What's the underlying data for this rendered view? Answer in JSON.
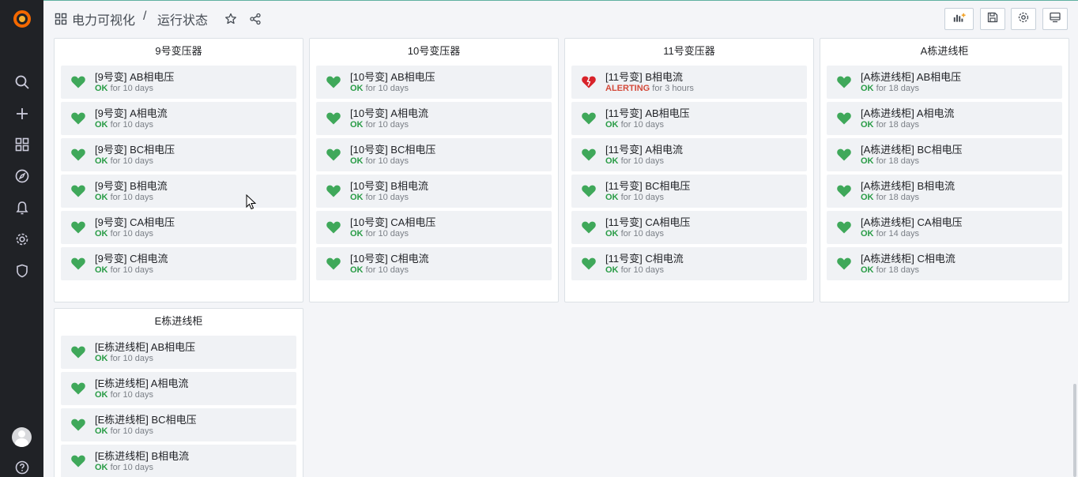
{
  "breadcrumb": {
    "folder": "电力可视化",
    "separator": "/",
    "dashboard": "运行状态"
  },
  "icons": {
    "logo": "grafana-logo-icon",
    "sidebar": [
      "search-icon",
      "plus-icon",
      "dashboards-grid-icon",
      "compass-explore-icon",
      "bell-alerting-icon",
      "gear-config-icon",
      "shield-icon"
    ],
    "help": "help-circle-icon",
    "toolbar": [
      "add-panel-icon",
      "save-icon",
      "settings-gear-icon",
      "tv-mode-icon"
    ]
  },
  "colors": {
    "sidebar_bg": "#202226",
    "ok": "#299c46",
    "alerting": "#d44a3a",
    "heart_ok": "#3fa85a",
    "heart_alert": "#d8232a"
  },
  "panels": [
    {
      "title": "9号变压器",
      "items": [
        {
          "name": "[9号变] AB相电压",
          "state": "OK",
          "duration": "for 10 days",
          "alert": false
        },
        {
          "name": "[9号变] A相电流",
          "state": "OK",
          "duration": "for 10 days",
          "alert": false
        },
        {
          "name": "[9号变] BC相电压",
          "state": "OK",
          "duration": "for 10 days",
          "alert": false
        },
        {
          "name": "[9号变] B相电流",
          "state": "OK",
          "duration": "for 10 days",
          "alert": false
        },
        {
          "name": "[9号变] CA相电压",
          "state": "OK",
          "duration": "for 10 days",
          "alert": false
        },
        {
          "name": "[9号变] C相电流",
          "state": "OK",
          "duration": "for 10 days",
          "alert": false
        }
      ]
    },
    {
      "title": "10号变压器",
      "items": [
        {
          "name": "[10号变] AB相电压",
          "state": "OK",
          "duration": "for 10 days",
          "alert": false
        },
        {
          "name": "[10号变] A相电流",
          "state": "OK",
          "duration": "for 10 days",
          "alert": false
        },
        {
          "name": "[10号变] BC相电压",
          "state": "OK",
          "duration": "for 10 days",
          "alert": false
        },
        {
          "name": "[10号变] B相电流",
          "state": "OK",
          "duration": "for 10 days",
          "alert": false
        },
        {
          "name": "[10号变] CA相电压",
          "state": "OK",
          "duration": "for 10 days",
          "alert": false
        },
        {
          "name": "[10号变] C相电流",
          "state": "OK",
          "duration": "for 10 days",
          "alert": false
        }
      ]
    },
    {
      "title": "11号变压器",
      "items": [
        {
          "name": "[11号变] B相电流",
          "state": "ALERTING",
          "duration": "for 3 hours",
          "alert": true
        },
        {
          "name": "[11号变] AB相电压",
          "state": "OK",
          "duration": "for 10 days",
          "alert": false
        },
        {
          "name": "[11号变] A相电流",
          "state": "OK",
          "duration": "for 10 days",
          "alert": false
        },
        {
          "name": "[11号变] BC相电压",
          "state": "OK",
          "duration": "for 10 days",
          "alert": false
        },
        {
          "name": "[11号变] CA相电压",
          "state": "OK",
          "duration": "for 10 days",
          "alert": false
        },
        {
          "name": "[11号变] C相电流",
          "state": "OK",
          "duration": "for 10 days",
          "alert": false
        }
      ]
    },
    {
      "title": "A栋进线柜",
      "items": [
        {
          "name": "[A栋进线柜] AB相电压",
          "state": "OK",
          "duration": "for 18 days",
          "alert": false
        },
        {
          "name": "[A栋进线柜] A相电流",
          "state": "OK",
          "duration": "for 18 days",
          "alert": false
        },
        {
          "name": "[A栋进线柜] BC相电压",
          "state": "OK",
          "duration": "for 18 days",
          "alert": false
        },
        {
          "name": "[A栋进线柜] B相电流",
          "state": "OK",
          "duration": "for 18 days",
          "alert": false
        },
        {
          "name": "[A栋进线柜] CA相电压",
          "state": "OK",
          "duration": "for 14 days",
          "alert": false
        },
        {
          "name": "[A栋进线柜] C相电流",
          "state": "OK",
          "duration": "for 18 days",
          "alert": false
        }
      ]
    },
    {
      "title": "E栋进线柜",
      "items": [
        {
          "name": "[E栋进线柜] AB相电压",
          "state": "OK",
          "duration": "for 10 days",
          "alert": false
        },
        {
          "name": "[E栋进线柜] A相电流",
          "state": "OK",
          "duration": "for 10 days",
          "alert": false
        },
        {
          "name": "[E栋进线柜] BC相电压",
          "state": "OK",
          "duration": "for 10 days",
          "alert": false
        },
        {
          "name": "[E栋进线柜] B相电流",
          "state": "OK",
          "duration": "for 10 days",
          "alert": false
        }
      ]
    }
  ]
}
